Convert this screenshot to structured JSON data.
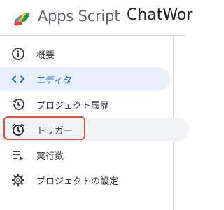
{
  "header": {
    "app_name": "Apps Script",
    "project_name": "ChatWor"
  },
  "nav": {
    "items": [
      {
        "label": "概要",
        "icon": "info-icon"
      },
      {
        "label": "エディタ",
        "icon": "code-icon"
      },
      {
        "label": "プロジェクト履歴",
        "icon": "history-icon"
      },
      {
        "label": "トリガー",
        "icon": "alarm-clock-icon"
      },
      {
        "label": "実行数",
        "icon": "executions-icon"
      },
      {
        "label": "プロジェクトの設定",
        "icon": "gear-icon"
      }
    ],
    "active_index": 1
  },
  "colors": {
    "accent": "#1a73e8",
    "active_bg": "#e8f0fe",
    "highlight_border": "#e2503c"
  }
}
